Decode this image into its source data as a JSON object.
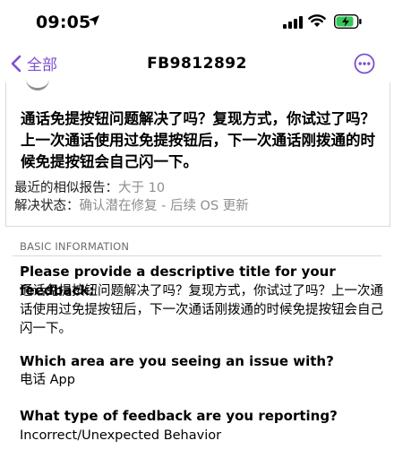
{
  "status": {
    "time": "09:05"
  },
  "nav": {
    "back_label": "全部",
    "title": "FB9812892"
  },
  "summary": {
    "title": "通话免提按钮问题解决了吗？复现方式，你试过了吗？上一次通话使用过免提按钮后，下一次通话刚拨通的时候免提按钮会自己闪一下。",
    "similar_reports_label": "最近的相似报告：",
    "similar_reports_value": "大于 10",
    "resolution_label": "解决状态：",
    "resolution_value": "确认潜在修复 - 后续 OS 更新"
  },
  "section": {
    "label": "BASIC INFORMATION",
    "items": [
      {
        "question": "Please provide a descriptive title for your feedback:",
        "answer": "通话免提按钮问题解决了吗？复现方式，你试过了吗？上一次通话使用过免提按钮后，下一次通话刚拨通的时候免提按钮会自己闪一下。"
      },
      {
        "question": "Which area are you seeing an issue with?",
        "answer": "电话 App"
      },
      {
        "question": "What type of feedback are you reporting?",
        "answer": "Incorrect/Unexpected Behavior"
      }
    ]
  },
  "colors": {
    "accent": "#7b4fd0",
    "battery": "#34c759"
  },
  "icons": [
    "location-arrow-icon",
    "cellular-signal-icon",
    "wifi-icon",
    "battery-charging-icon",
    "chevron-left-icon",
    "more-ellipsis-icon"
  ]
}
